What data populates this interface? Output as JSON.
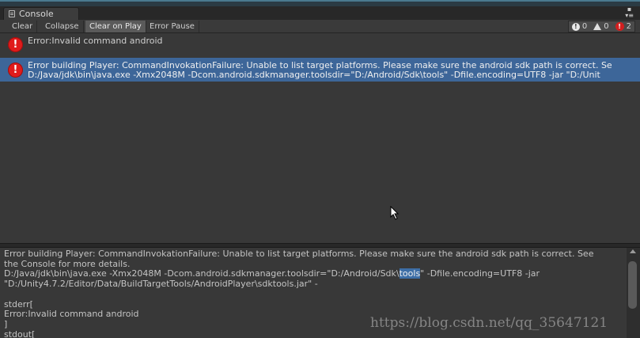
{
  "window": {
    "tab_label": "Console",
    "menu_glyph": "▾≡",
    "close_glyph": "▪"
  },
  "toolbar": {
    "clear": "Clear",
    "collapse": "Collapse",
    "clear_on_play": "Clear on Play",
    "error_pause": "Error Pause",
    "counts": {
      "info": "0",
      "warning": "0",
      "error": "2"
    }
  },
  "log": {
    "entries": [
      {
        "icon": "error-icon",
        "line1": "Error:Invalid command android",
        "line2": ""
      },
      {
        "icon": "error-icon",
        "line1": "Error building Player: CommandInvokationFailure: Unable to list target platforms. Please make sure the android sdk path is correct. Se",
        "line2": "D:/Java/jdk\\bin\\java.exe -Xmx2048M -Dcom.android.sdkmanager.toolsdir=\"D:/Android/Sdk\\tools\" -Dfile.encoding=UTF8 -jar \"D:/Unit"
      }
    ]
  },
  "detail": {
    "line1": "Error building Player: CommandInvokationFailure: Unable to list target platforms. Please make sure the android sdk path is correct. See",
    "line2": "the Console for more details.",
    "line3_pre": "D:/Java/jdk\\bin\\java.exe -Xmx2048M -Dcom.android.sdkmanager.toolsdir=\"D:/Android/Sdk\\",
    "line3_hl": "tools",
    "line3_post": "\" -Dfile.encoding=UTF8 -jar",
    "line4": "\"D:/Unity4.7.2/Editor/Data/BuildTargetTools/AndroidPlayer\\sdktools.jar\" -",
    "line5": "",
    "line6": "stderr[",
    "line7": "Error:Invalid command android",
    "line8": "]",
    "line9": "stdout["
  },
  "watermark": "https://blog.csdn.net/qq_35647121",
  "colors": {
    "selection": "#3d6699",
    "error": "#e01b1b",
    "panel": "#383838"
  }
}
